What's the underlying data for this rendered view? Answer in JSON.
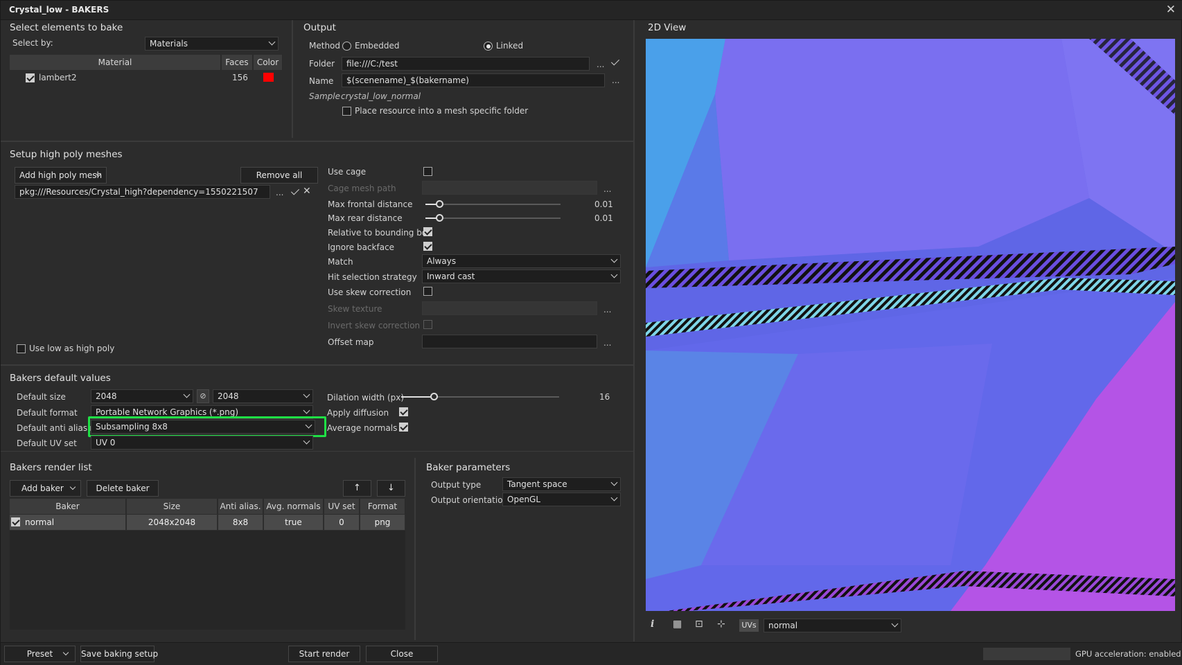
{
  "window": {
    "title": "Crystal_low - BAKERS",
    "close_glyph": "✕"
  },
  "select": {
    "title": "Select elements to bake",
    "select_by_label": "Select by:",
    "select_by_value": "Materials",
    "table": {
      "headers": [
        "Material",
        "Faces",
        "Color"
      ],
      "rows": [
        {
          "checked": true,
          "name": "lambert2",
          "faces": "156",
          "color": "#ff0000"
        }
      ]
    }
  },
  "output": {
    "title": "Output",
    "method_label": "Method",
    "method_options": [
      "Embedded",
      "Linked"
    ],
    "method_selected": "Linked",
    "folder_label": "Folder",
    "folder_value": "file:///C:/test",
    "name_label": "Name",
    "name_value": "$(scenename)_$(bakername)",
    "sample_label": "Sample",
    "sample_value": "crystal_low_normal",
    "place_resource_label": "Place resource into a mesh specific folder",
    "place_resource_checked": false,
    "ellipsis": "..."
  },
  "highpoly": {
    "title": "Setup high poly meshes",
    "add_label": "Add high poly mesh",
    "remove_all_label": "Remove all",
    "mesh_path": "pkg:///Resources/Crystal_high?dependency=1550221507",
    "use_low_label": "Use low as high poly",
    "use_low_checked": false,
    "use_cage_label": "Use cage",
    "use_cage_checked": false,
    "cage_mesh_path_label": "Cage mesh path",
    "max_frontal_label": "Max frontal distance",
    "max_frontal_value": "0.01",
    "max_frontal_fraction": 0.01,
    "max_rear_label": "Max rear distance",
    "max_rear_value": "0.01",
    "max_rear_fraction": 0.01,
    "relative_bbox_label": "Relative to bounding box",
    "relative_bbox_checked": true,
    "ignore_backface_label": "Ignore backface",
    "ignore_backface_checked": true,
    "match_label": "Match",
    "match_value": "Always",
    "hit_strategy_label": "Hit selection strategy",
    "hit_strategy_value": "Inward cast",
    "skew_label": "Use skew correction",
    "skew_checked": false,
    "skew_texture_label": "Skew texture",
    "invert_skew_label": "Invert skew correction",
    "offset_map_label": "Offset map"
  },
  "defaults": {
    "title": "Bakers default values",
    "size_label": "Default size",
    "size_w": "2048",
    "size_h": "2048",
    "format_label": "Default format",
    "format_value": "Portable Network Graphics (*.png)",
    "aa_label": "Default anti aliasing",
    "aa_value": "Subsampling 8x8",
    "uv_label": "Default UV set",
    "uv_value": "UV 0",
    "dilation_label": "Dilation width (px)",
    "dilation_value": "16",
    "dilation_fraction": 0.125,
    "diffusion_label": "Apply diffusion",
    "diffusion_checked": true,
    "avg_normals_label": "Average normals",
    "avg_normals_checked": true
  },
  "renderlist": {
    "title": "Bakers render list",
    "add_label": "Add baker",
    "delete_label": "Delete baker",
    "up_glyph": "↑",
    "down_glyph": "↓",
    "headers": [
      "Baker",
      "Size",
      "Anti alias.",
      "Avg. normals",
      "UV set",
      "Format"
    ],
    "rows": [
      {
        "checked": true,
        "baker": "normal",
        "size": "2048x2048",
        "aa": "8x8",
        "avg": "true",
        "uv": "0",
        "format": "png"
      }
    ]
  },
  "params": {
    "title": "Baker parameters",
    "output_type_label": "Output type",
    "output_type_value": "Tangent space",
    "orientation_label": "Output orientation",
    "orientation_value": "OpenGL"
  },
  "view": {
    "title": "2D View",
    "uvs_label": "UVs",
    "channel_value": "normal",
    "info_glyph": "i"
  },
  "footer": {
    "preset_label": "Preset",
    "save_label": "Save baking setup",
    "start_label": "Start render",
    "close_label": "Close",
    "gpu_label": "GPU acceleration: enabled"
  },
  "colors": {
    "highlight": "#1fe045",
    "accent_red": "#ff0000",
    "view_base": "#5f66e6"
  }
}
